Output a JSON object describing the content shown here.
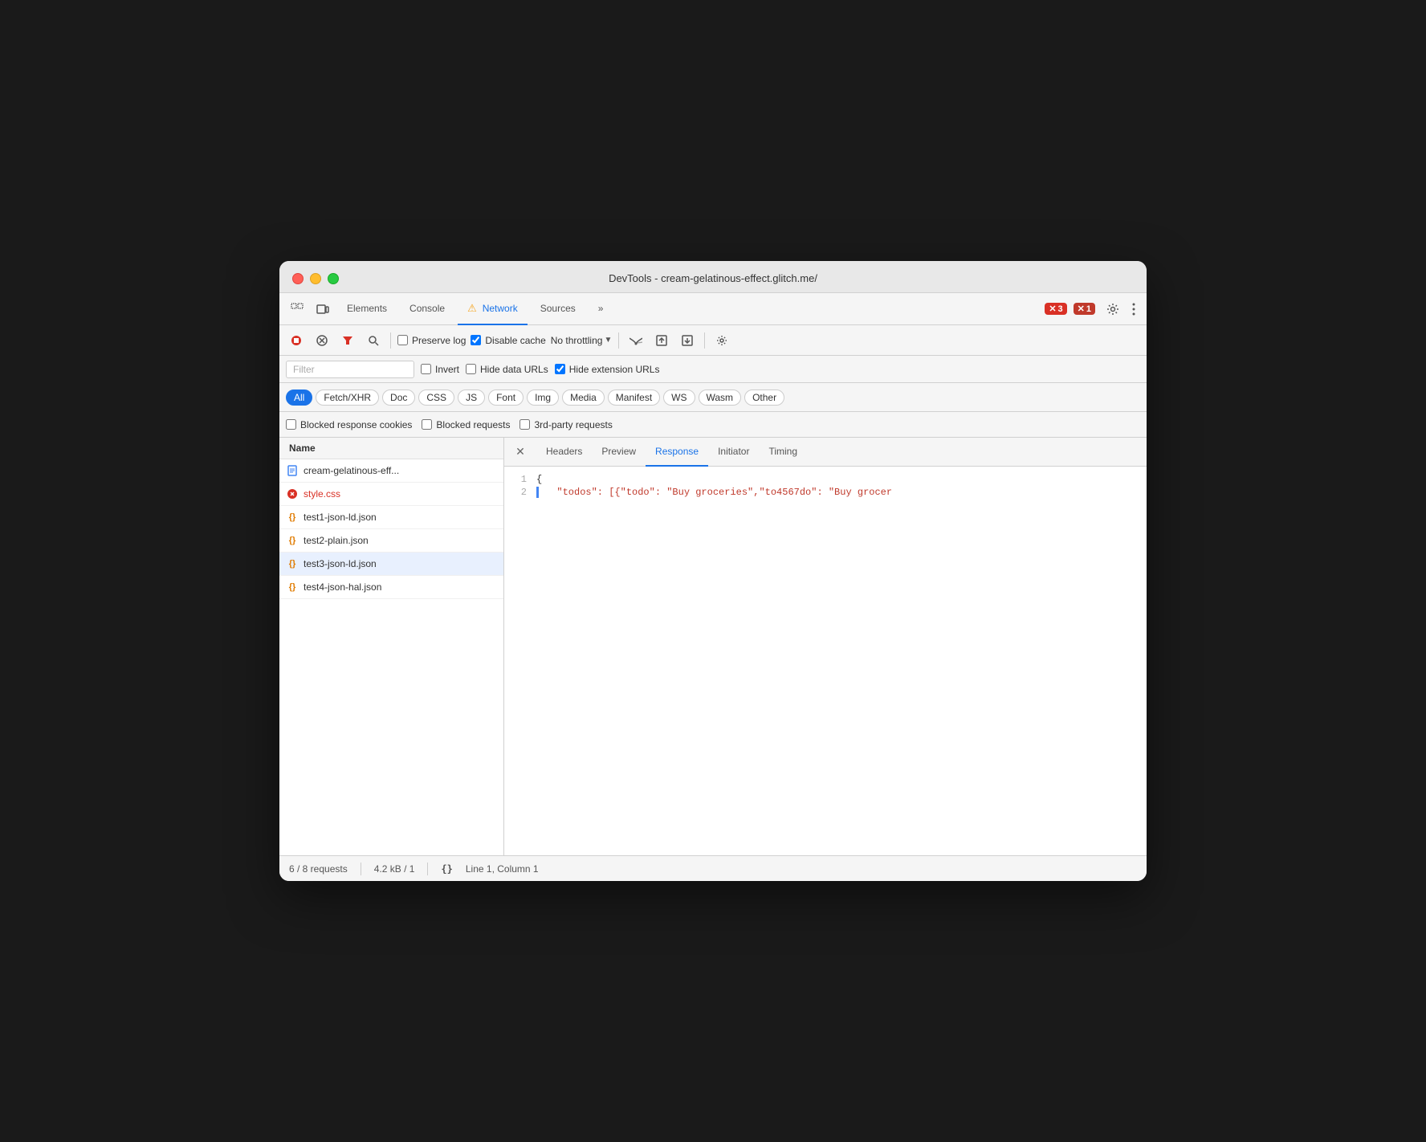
{
  "window": {
    "title": "DevTools - cream-gelatinous-effect.glitch.me/"
  },
  "tabs": {
    "items": [
      {
        "label": "Elements",
        "active": false
      },
      {
        "label": "Console",
        "active": false
      },
      {
        "label": "Network",
        "active": true
      },
      {
        "label": "Sources",
        "active": false
      },
      {
        "label": "»",
        "active": false
      }
    ]
  },
  "header": {
    "error_count": "3",
    "warning_count": "1"
  },
  "toolbar": {
    "preserve_log": false,
    "disable_cache": true,
    "throttling": "No throttling",
    "filter_placeholder": "Filter",
    "invert": false,
    "hide_data_urls": false,
    "hide_extension_urls": true
  },
  "filter_buttons": [
    {
      "label": "All",
      "active": true
    },
    {
      "label": "Fetch/XHR",
      "active": false
    },
    {
      "label": "Doc",
      "active": false
    },
    {
      "label": "CSS",
      "active": false
    },
    {
      "label": "JS",
      "active": false
    },
    {
      "label": "Font",
      "active": false
    },
    {
      "label": "Img",
      "active": false
    },
    {
      "label": "Media",
      "active": false
    },
    {
      "label": "Manifest",
      "active": false
    },
    {
      "label": "WS",
      "active": false
    },
    {
      "label": "Wasm",
      "active": false
    },
    {
      "label": "Other",
      "active": false
    }
  ],
  "checkboxes": {
    "blocked_cookies": false,
    "blocked_requests": false,
    "third_party": false,
    "blocked_cookies_label": "Blocked response cookies",
    "blocked_requests_label": "Blocked requests",
    "third_party_label": "3rd-party requests"
  },
  "file_list": {
    "header": "Name",
    "items": [
      {
        "name": "cream-gelatinous-eff...",
        "type": "doc",
        "error": false,
        "selected": false
      },
      {
        "name": "style.css",
        "type": "error",
        "error": true,
        "selected": false
      },
      {
        "name": "test1-json-ld.json",
        "type": "json",
        "error": false,
        "selected": false
      },
      {
        "name": "test2-plain.json",
        "type": "json",
        "error": false,
        "selected": false
      },
      {
        "name": "test3-json-ld.json",
        "type": "json",
        "error": false,
        "selected": true
      },
      {
        "name": "test4-json-hal.json",
        "type": "json",
        "error": false,
        "selected": false
      }
    ]
  },
  "response_tabs": {
    "items": [
      {
        "label": "Headers",
        "active": false
      },
      {
        "label": "Preview",
        "active": false
      },
      {
        "label": "Response",
        "active": true
      },
      {
        "label": "Initiator",
        "active": false
      },
      {
        "label": "Timing",
        "active": false
      }
    ]
  },
  "code_content": {
    "line1": "{",
    "line2_part1": "  \"todos\": [{\"todo\": \"Buy groceries\",\"to4567do\": \"Buy grocer"
  },
  "status_bar": {
    "requests": "6 / 8 requests",
    "size": "4.2 kB / 1",
    "position": "Line 1, Column 1"
  }
}
